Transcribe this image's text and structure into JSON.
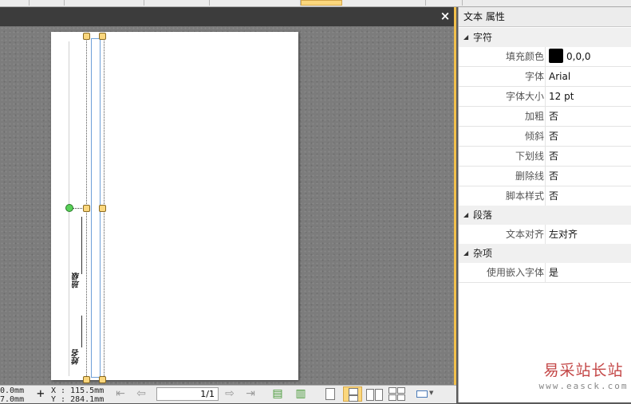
{
  "canvas": {
    "close_label": "×",
    "page_vertical_texts": [
      "姓名",
      "班级"
    ]
  },
  "statusbar": {
    "w_value": "0.0mm",
    "h_value": "7.0mm",
    "x_label": "X : 115.5mm",
    "y_label": "Y : 284.1mm",
    "page_indicator": "1/1"
  },
  "panel": {
    "title": "文本 属性",
    "sections": {
      "char": "字符",
      "para": "段落",
      "misc": "杂项"
    },
    "char_rows": [
      {
        "label": "填充颜色",
        "value": "0,0,0"
      },
      {
        "label": "字体",
        "value": "Arial"
      },
      {
        "label": "字体大小",
        "value": "12 pt"
      },
      {
        "label": "加粗",
        "value": "否"
      },
      {
        "label": "倾斜",
        "value": "否"
      },
      {
        "label": "下划线",
        "value": "否"
      },
      {
        "label": "删除线",
        "value": "否"
      },
      {
        "label": "脚本样式",
        "value": "否"
      }
    ],
    "para_rows": [
      {
        "label": "文本对齐",
        "value": "左对齐"
      }
    ],
    "misc_rows": [
      {
        "label": "使用嵌入字体",
        "value": "是"
      }
    ],
    "fill_color": "#000000"
  },
  "watermark": {
    "line1": "易采站长站",
    "line2": "www.easck.com"
  }
}
